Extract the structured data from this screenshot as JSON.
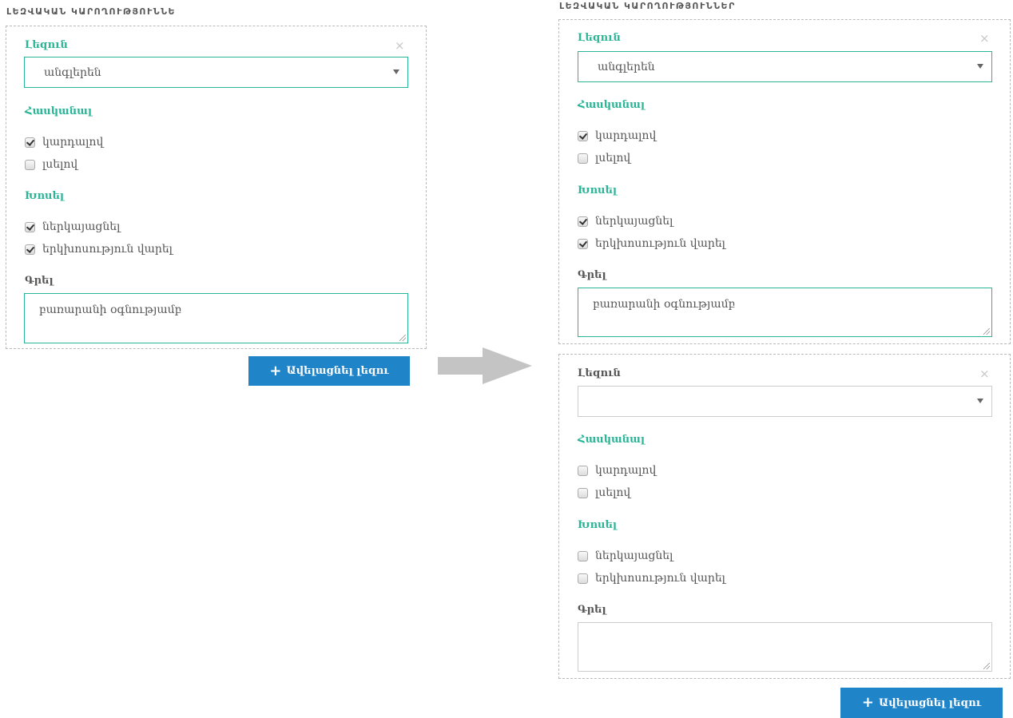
{
  "left": {
    "heading": "ԼԵԶՎԱԿԱՆ ԿԱՐՈՂՈՒԹՅՈՒՆՆԵ",
    "entry": {
      "language_label": "Լեզուն",
      "close_glyph": "×",
      "language_value": "անգլերեն",
      "understand_label": "Հասկանալ",
      "understand_options": [
        {
          "label": "կարդալով",
          "checked": true
        },
        {
          "label": "լսելով",
          "checked": false
        }
      ],
      "speak_label": "Խոսել",
      "speak_options": [
        {
          "label": "ներկայացնել",
          "checked": true
        },
        {
          "label": "երկխոսություն վարել",
          "checked": true
        }
      ],
      "write_label": "Գրել",
      "write_value": "բառարանի օգնությամբ"
    },
    "add_button": "Ավելացնել լեզու"
  },
  "right": {
    "heading": "ԼԵԶՎԱԿԱՆ ԿԱՐՈՂՈՒԹՅՈՒՆՆԵՐ",
    "entry1": {
      "language_label": "Լեզուն",
      "close_glyph": "×",
      "language_value": "անգլերեն",
      "understand_label": "Հասկանալ",
      "understand_options": [
        {
          "label": "կարդալով",
          "checked": true
        },
        {
          "label": "լսելով",
          "checked": false
        }
      ],
      "speak_label": "Խոսել",
      "speak_options": [
        {
          "label": "ներկայացնել",
          "checked": true
        },
        {
          "label": "երկխոսություն վարել",
          "checked": true
        }
      ],
      "write_label": "Գրել",
      "write_value": "բառարանի օգնությամբ"
    },
    "entry2": {
      "language_label": "Լեզուն",
      "close_glyph": "×",
      "language_value": "",
      "understand_label": "Հասկանալ",
      "understand_options": [
        {
          "label": "կարդալով",
          "checked": false
        },
        {
          "label": "լսելով",
          "checked": false
        }
      ],
      "speak_label": "Խոսել",
      "speak_options": [
        {
          "label": "ներկայացնել",
          "checked": false
        },
        {
          "label": "երկխոսություն վարել",
          "checked": false
        }
      ],
      "write_label": "Գրել",
      "write_value": ""
    },
    "add_button": "Ավելացնել լեզու"
  },
  "colors": {
    "accent": "#2bb597",
    "button": "#1f84c8",
    "arrow": "#c4c4c4"
  },
  "icons": {
    "close": "close-icon",
    "dropdown": "caret-down-icon",
    "add": "plus-icon",
    "arrow": "arrow-right-icon"
  }
}
